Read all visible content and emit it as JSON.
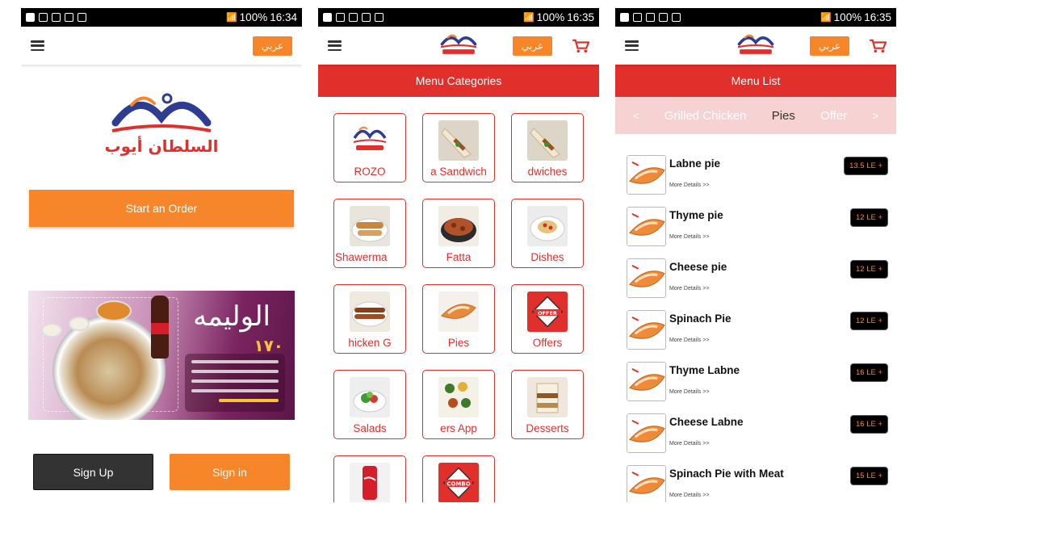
{
  "status": {
    "battery": "100%",
    "times": [
      "16:34",
      "16:35",
      "16:35"
    ]
  },
  "common": {
    "lang_label": "عربي"
  },
  "welcome": {
    "start_order": "Start an Order",
    "sign_up": "Sign Up",
    "sign_in": "Sign in",
    "banner": {
      "title": "الوليمه",
      "price": "١٧٠"
    }
  },
  "categories": {
    "header": "Menu Categories",
    "tiles": [
      {
        "label": "ROZO",
        "icon": "logo",
        "clip": "none"
      },
      {
        "label": "a Sandwich",
        "icon": "wrap",
        "clip": "none"
      },
      {
        "label": "dwiches",
        "icon": "wrap",
        "clip": "none"
      },
      {
        "label": "Shawerma",
        "icon": "shawerma-plate",
        "clip": "left"
      },
      {
        "label": "Fatta",
        "icon": "fatta-plate",
        "clip": "none"
      },
      {
        "label": "Dishes",
        "icon": "pasta-plate",
        "clip": "none"
      },
      {
        "label": "hicken    G",
        "icon": "grill-plate",
        "clip": "none"
      },
      {
        "label": "Pies",
        "icon": "pie",
        "clip": "none"
      },
      {
        "label": "Offers",
        "icon": "offer-badge",
        "clip": "none"
      },
      {
        "label": "Salads",
        "icon": "salad-plate",
        "clip": "none"
      },
      {
        "label": "ers     App",
        "icon": "appetizer-plate",
        "clip": "none"
      },
      {
        "label": "Desserts",
        "icon": "dessert-cup",
        "clip": "none"
      },
      {
        "label": "",
        "icon": "cola-can",
        "clip": "none"
      },
      {
        "label": "",
        "icon": "combo-badge",
        "clip": "none"
      }
    ]
  },
  "menu_list": {
    "header": "Menu List",
    "category_bar": {
      "prev": "<",
      "next": ">",
      "items": [
        "Grilled Chicken",
        "Pies",
        "Offer"
      ],
      "active": "Pies"
    },
    "items": [
      {
        "name": "Labne pie",
        "more": "More Details >>",
        "price": "13.5 LE +"
      },
      {
        "name": "Thyme pie",
        "more": "More Details >>",
        "price": "12 LE +"
      },
      {
        "name": "Cheese pie",
        "more": "More Details >>",
        "price": "12 LE +"
      },
      {
        "name": "Spinach Pie",
        "more": "More Details >>",
        "price": "12 LE +"
      },
      {
        "name": "Thyme Labne",
        "more": "More Details >>",
        "price": "16 LE +"
      },
      {
        "name": "Cheese Labne",
        "more": "More Details >>",
        "price": "16 LE +"
      },
      {
        "name": "Spinach Pie with Meat",
        "more": "More Details >>",
        "price": "15 LE +"
      }
    ]
  },
  "colors": {
    "accent_orange": "#f7852a",
    "brand_red": "#e12f2c",
    "brand_blue": "#2e3d8f",
    "light_pink": "#f6d3d2"
  }
}
